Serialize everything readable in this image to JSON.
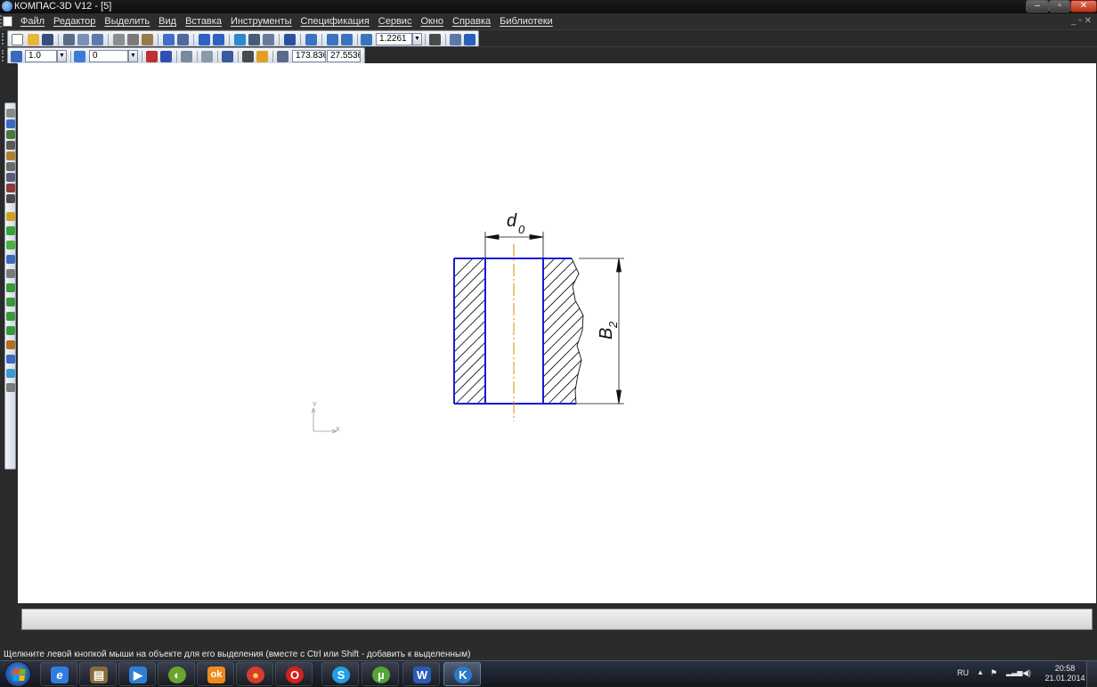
{
  "window": {
    "title": "КОМПАС-3D V12 - [5]",
    "controls": {
      "minimize": "–",
      "maximize": "▫",
      "close": "✕"
    }
  },
  "menu": {
    "items": [
      "Файл",
      "Редактор",
      "Выделить",
      "Вид",
      "Вставка",
      "Инструменты",
      "Спецификация",
      "Сервис",
      "Окно",
      "Справка",
      "Библиотеки"
    ],
    "doc_controls": "_ ▫ ✕"
  },
  "toolbar1": {
    "zoom_value": "1.2261"
  },
  "toolbar2": {
    "step_value": "1.0",
    "layer_value": "0",
    "coord_x": "173.836",
    "coord_y": "27.5536"
  },
  "drawing": {
    "dim_top_label": "d",
    "dim_top_sub": "0",
    "dim_right_label": "B",
    "dim_right_sub": "2",
    "axis_y_label": "Y",
    "axis_x_label": "X",
    "colors": {
      "contour": "#1b1bd6",
      "hatch": "#111111",
      "centerline": "#e08a00"
    }
  },
  "status": {
    "message": "Щелкните левой кнопкой мыши на объекте для его выделения (вместе с Ctrl или Shift - добавить к выделенным)"
  },
  "taskbar": {
    "apps": [
      {
        "name": "ie",
        "glyph": "e",
        "color": "#2f7de1"
      },
      {
        "name": "files",
        "glyph": "▤",
        "color": "#8a6a3a"
      },
      {
        "name": "media",
        "glyph": "▶",
        "color": "#2d7fd3"
      },
      {
        "name": "chrome-like",
        "glyph": "◐",
        "color": "#6aa52f"
      },
      {
        "name": "odnoklassniki",
        "glyph": "ok",
        "color": "#f08a1c"
      },
      {
        "name": "chrome",
        "glyph": "●",
        "color": "#d83b2d"
      },
      {
        "name": "opera",
        "glyph": "O",
        "color": "#d42020"
      },
      {
        "name": "skype",
        "glyph": "S",
        "color": "#1f9ee3"
      },
      {
        "name": "utorrent",
        "glyph": "µ",
        "color": "#56a33a"
      },
      {
        "name": "word",
        "glyph": "W",
        "color": "#2a5bb5"
      },
      {
        "name": "kompas",
        "glyph": "K",
        "color": "#2a7ac9"
      }
    ],
    "tray": {
      "language": "RU",
      "time": "20:58",
      "date": "21.01.2014"
    }
  }
}
